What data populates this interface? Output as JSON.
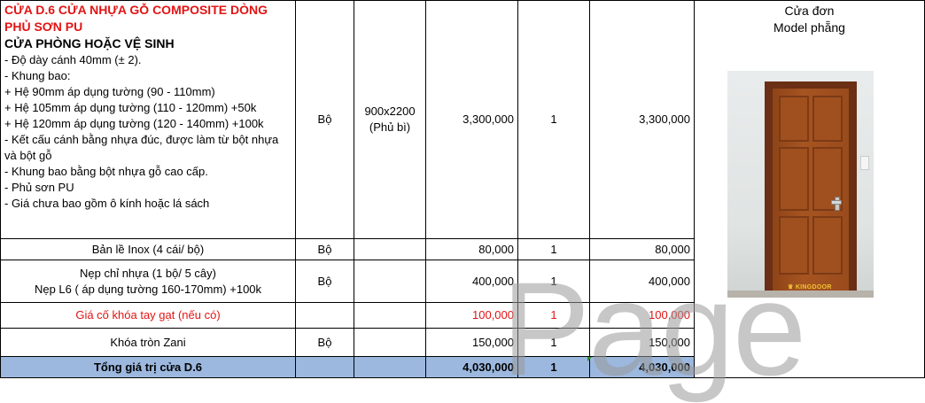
{
  "door_item": {
    "title": "CỬA D.6 CỬA NHỰA GỖ COMPOSITE DÒNG PHỦ SƠN PU",
    "subtitle": "CỬA PHÒNG HOẶC VỆ SINH",
    "lines": [
      "- Độ dày cánh 40mm (± 2).",
      "- Khung bao:",
      "+ Hệ 90mm áp dụng tường (90 - 110mm)",
      "+ Hệ 105mm áp dụng tường (110 - 120mm) +50k",
      "+ Hệ 120mm áp dụng tường (120 - 140mm) +100k",
      "- Kết cấu cánh bằng nhựa đúc, được làm từ bột nhựa và bột gỗ",
      "- Khung bao bằng bột nhựa gỗ cao cấp.",
      "- Phủ sơn PU",
      "- Giá chưa bao gồm ô kính hoặc lá sách"
    ],
    "unit": "Bộ",
    "size_line1": "900x2200",
    "size_line2": "(Phủ bì)",
    "unit_price": "3,300,000",
    "qty": "1",
    "amount": "3,300,000"
  },
  "image_caption": {
    "line1": "Cửa đơn",
    "line2": "Model phẵng",
    "logo_text": "KINGDOOR"
  },
  "rows": [
    {
      "name": "Bản lề Inox  (4 cái/ bộ)",
      "unit": "Bộ",
      "unit_price": "80,000",
      "qty": "1",
      "amount": "80,000"
    },
    {
      "name_line1": "Nẹp chỉ nhựa (1 bộ/ 5 cây)",
      "name_line2": "Nẹp L6 ( áp dụng tường 160-170mm) +100k",
      "unit": "Bộ",
      "unit_price": "400,000",
      "qty": "1",
      "amount": "400,000"
    },
    {
      "name": "Giá cố khóa tay gạt (nếu có)",
      "unit_price": "100,000",
      "qty": "1",
      "amount": "100,000"
    },
    {
      "name": "Khóa tròn Zani",
      "unit": "Bộ",
      "unit_price": "150,000",
      "qty": "1",
      "amount": "150,000"
    }
  ],
  "total": {
    "label": "Tổng giá trị cửa D.6",
    "unit_price": "4,030,000",
    "qty": "1",
    "amount": "4,030,000"
  },
  "watermark": "Page",
  "colors": {
    "title_red": "#e31414",
    "total_bg": "#9cb8df"
  }
}
